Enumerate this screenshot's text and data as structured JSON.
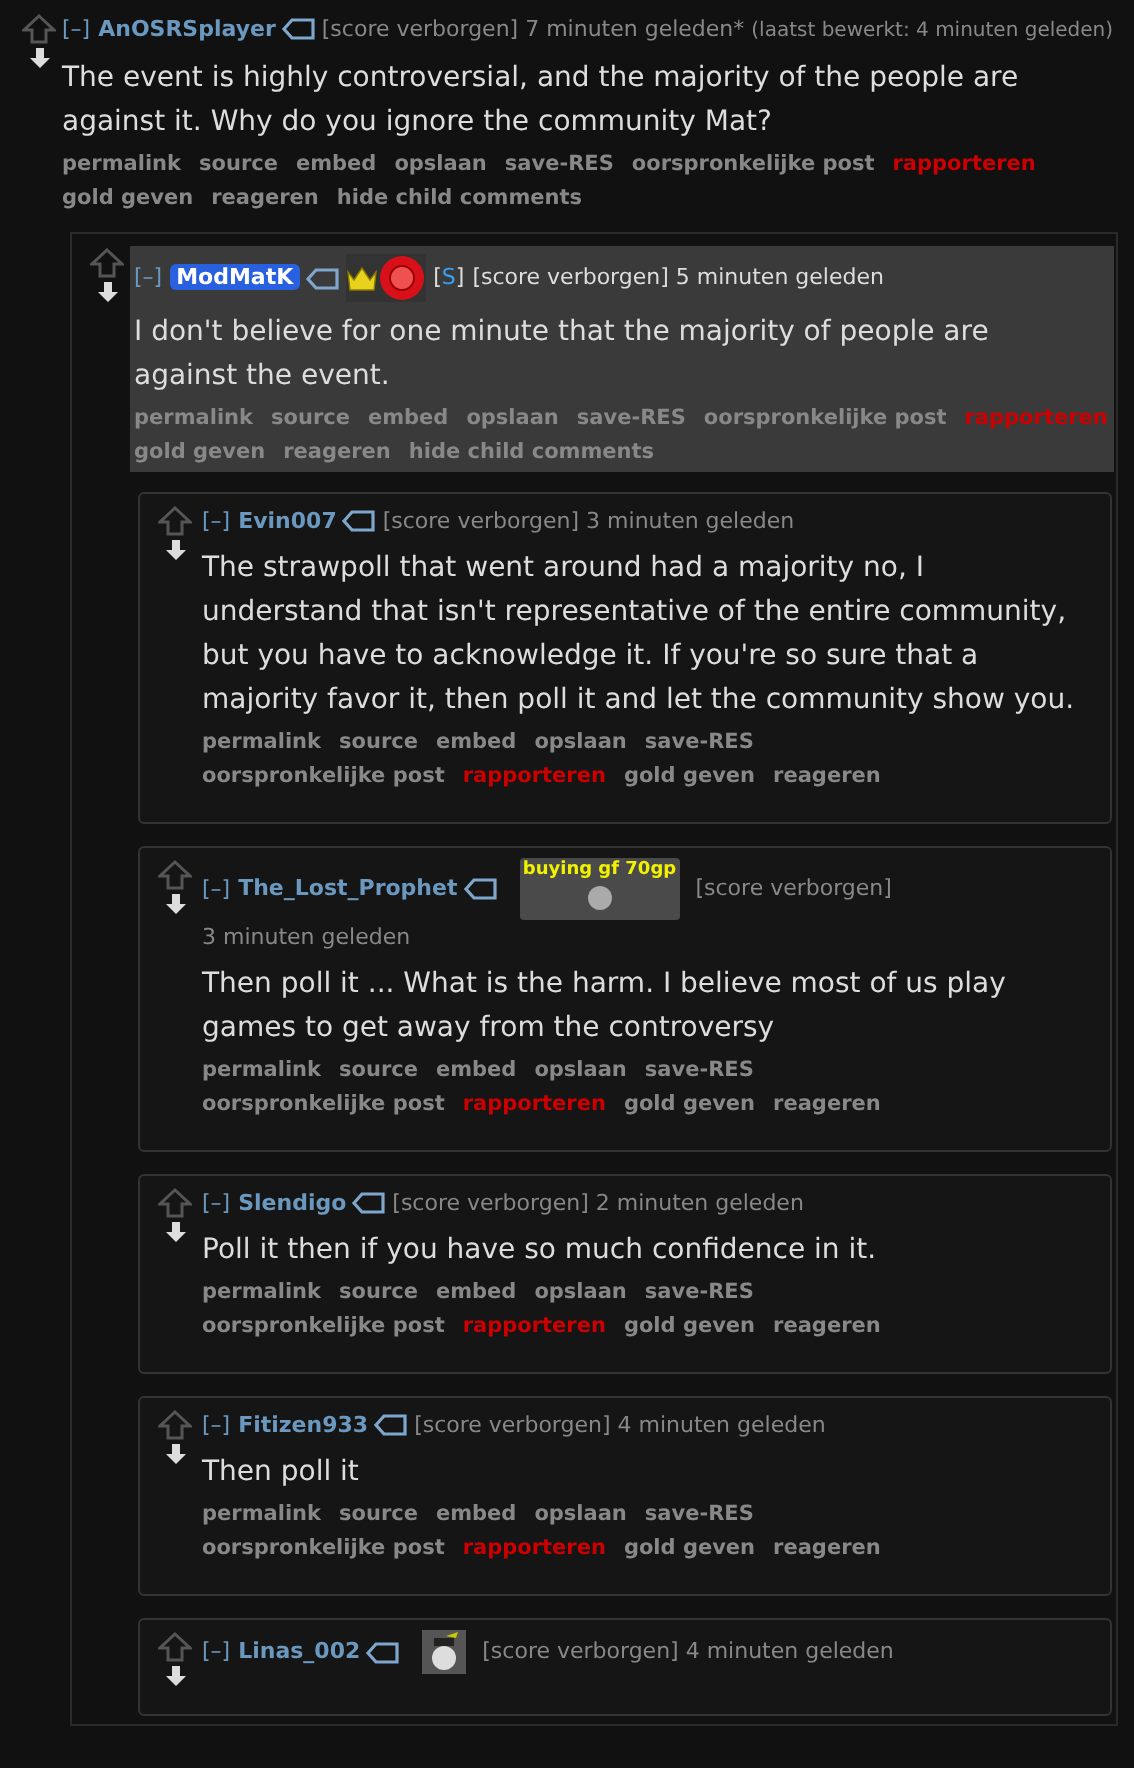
{
  "comments": [
    {
      "collapse": "[–]",
      "author": "AnOSRSplayer",
      "moderator": false,
      "score": "[score verborgen]",
      "time": "7 minuten geleden*",
      "edited": "(laatst bewerkt: 4 minuten geleden)",
      "highlighted": false,
      "body": "The event is highly controversial, and the majority of the people are against it. Why do you ignore the community Mat?",
      "actions": [
        {
          "label": "permalink",
          "kind": "link"
        },
        {
          "label": "source",
          "kind": "link"
        },
        {
          "label": "embed",
          "kind": "link"
        },
        {
          "label": "opslaan",
          "kind": "link"
        },
        {
          "label": "save-RES",
          "kind": "link"
        },
        {
          "label": "oorspronkelijke post",
          "kind": "link"
        },
        {
          "label": "rapporteren",
          "kind": "report"
        },
        {
          "label": "gold geven",
          "kind": "link"
        },
        {
          "label": "reageren",
          "kind": "link"
        },
        {
          "label": "hide child comments",
          "kind": "link"
        }
      ],
      "children": [
        {
          "collapse": "[–]",
          "author": "ModMatK",
          "moderator": true,
          "badges": [
            {
              "kind": "crown"
            },
            {
              "kind": "rosette"
            }
          ],
          "mod_tag": {
            "open": "[",
            "letter": "S",
            "close": "]"
          },
          "score": "[score verborgen]",
          "time": "5 minuten geleden",
          "highlighted": true,
          "body": "I don't believe for one minute that the majority of people are against the event.",
          "actions": [
            {
              "label": "permalink",
              "kind": "link"
            },
            {
              "label": "source",
              "kind": "link"
            },
            {
              "label": "embed",
              "kind": "link"
            },
            {
              "label": "opslaan",
              "kind": "link"
            },
            {
              "label": "save-RES",
              "kind": "link"
            },
            {
              "label": "oorspronkelijke post",
              "kind": "link"
            },
            {
              "label": "rapporteren",
              "kind": "report"
            },
            {
              "label": "gold geven",
              "kind": "link"
            },
            {
              "label": "reageren",
              "kind": "link"
            },
            {
              "label": "hide child comments",
              "kind": "link"
            }
          ],
          "children": [
            {
              "collapse": "[–]",
              "author": "Evin007",
              "moderator": false,
              "score": "[score verborgen]",
              "time": "3 minuten geleden",
              "highlighted": false,
              "body": "The strawpoll that went around had a majority no, I understand that isn't representative of the entire community, but you have to acknowledge it. If you're so sure that a majority favor it, then poll it and let the community show you.",
              "actions": [
                {
                  "label": "permalink",
                  "kind": "link"
                },
                {
                  "label": "source",
                  "kind": "link"
                },
                {
                  "label": "embed",
                  "kind": "link"
                },
                {
                  "label": "opslaan",
                  "kind": "link"
                },
                {
                  "label": "save-RES",
                  "kind": "link"
                },
                {
                  "label": "oorspronkelijke post",
                  "kind": "link"
                },
                {
                  "label": "rapporteren",
                  "kind": "report"
                },
                {
                  "label": "gold geven",
                  "kind": "link"
                },
                {
                  "label": "reageren",
                  "kind": "link"
                }
              ]
            },
            {
              "collapse": "[–]",
              "author": "The_Lost_Prophet",
              "moderator": false,
              "flair": {
                "kind": "text_image",
                "text": "buying gf 70gp"
              },
              "score": "[score verborgen]",
              "time": "3 minuten geleden",
              "highlighted": false,
              "body": "Then poll it ... What is the harm. I believe most of us play games to get away from the controversy",
              "actions": [
                {
                  "label": "permalink",
                  "kind": "link"
                },
                {
                  "label": "source",
                  "kind": "link"
                },
                {
                  "label": "embed",
                  "kind": "link"
                },
                {
                  "label": "opslaan",
                  "kind": "link"
                },
                {
                  "label": "save-RES",
                  "kind": "link"
                },
                {
                  "label": "oorspronkelijke post",
                  "kind": "link"
                },
                {
                  "label": "rapporteren",
                  "kind": "report"
                },
                {
                  "label": "gold geven",
                  "kind": "link"
                },
                {
                  "label": "reageren",
                  "kind": "link"
                }
              ]
            },
            {
              "collapse": "[–]",
              "author": "Slendigo",
              "moderator": false,
              "score": "[score verborgen]",
              "time": "2 minuten geleden",
              "highlighted": false,
              "body": "Poll it then if you have so much confidence in it.",
              "actions": [
                {
                  "label": "permalink",
                  "kind": "link"
                },
                {
                  "label": "source",
                  "kind": "link"
                },
                {
                  "label": "embed",
                  "kind": "link"
                },
                {
                  "label": "opslaan",
                  "kind": "link"
                },
                {
                  "label": "save-RES",
                  "kind": "link"
                },
                {
                  "label": "oorspronkelijke post",
                  "kind": "link"
                },
                {
                  "label": "rapporteren",
                  "kind": "report"
                },
                {
                  "label": "gold geven",
                  "kind": "link"
                },
                {
                  "label": "reageren",
                  "kind": "link"
                }
              ]
            },
            {
              "collapse": "[–]",
              "author": "Fitizen933",
              "moderator": false,
              "score": "[score verborgen]",
              "time": "4 minuten geleden",
              "highlighted": false,
              "body": "Then poll it",
              "actions": [
                {
                  "label": "permalink",
                  "kind": "link"
                },
                {
                  "label": "source",
                  "kind": "link"
                },
                {
                  "label": "embed",
                  "kind": "link"
                },
                {
                  "label": "opslaan",
                  "kind": "link"
                },
                {
                  "label": "save-RES",
                  "kind": "link"
                },
                {
                  "label": "oorspronkelijke post",
                  "kind": "link"
                },
                {
                  "label": "rapporteren",
                  "kind": "report"
                },
                {
                  "label": "gold geven",
                  "kind": "link"
                },
                {
                  "label": "reageren",
                  "kind": "link"
                }
              ]
            },
            {
              "collapse": "[–]",
              "author": "Linas_002",
              "moderator": false,
              "score": "[score verborgen]",
              "time": "4 minuten geleden",
              "highlighted": false
            }
          ]
        }
      ]
    }
  ]
}
